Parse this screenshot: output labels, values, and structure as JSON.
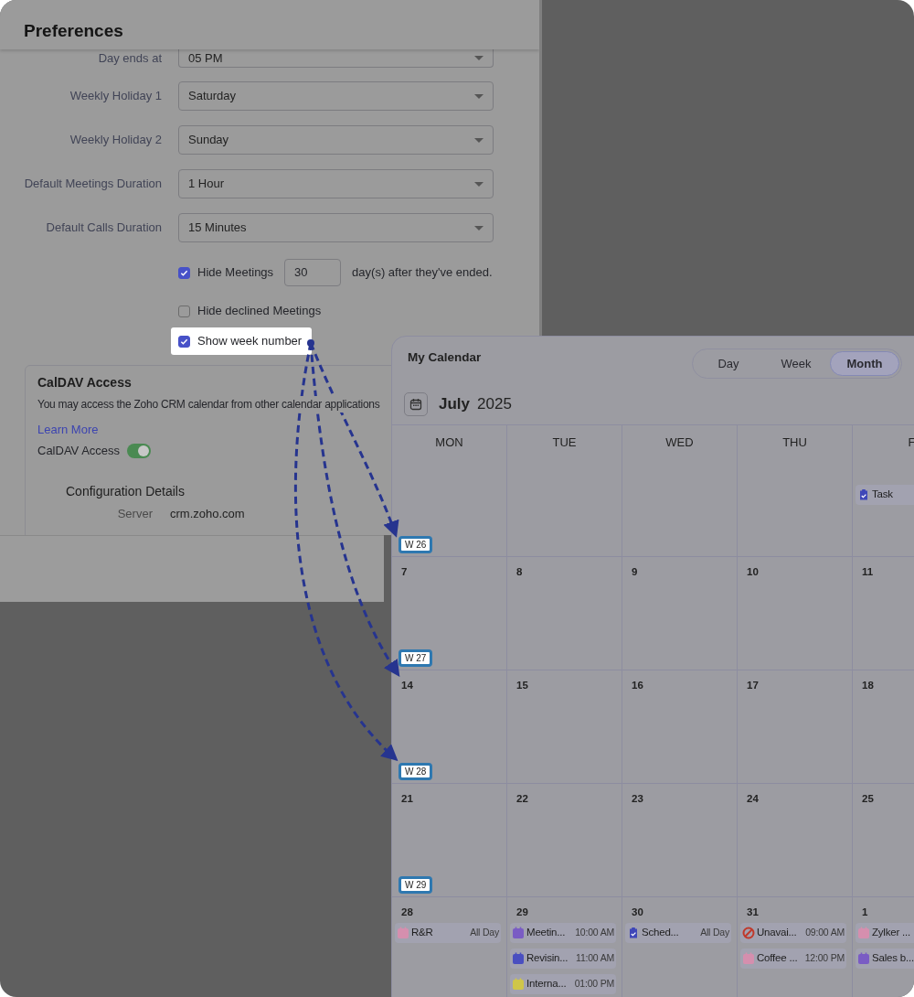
{
  "preferences": {
    "title": "Preferences",
    "fields": [
      {
        "label": "Day ends at",
        "value": "05 PM"
      },
      {
        "label": "Weekly Holiday 1",
        "value": "Saturday"
      },
      {
        "label": "Weekly Holiday 2",
        "value": "Sunday"
      },
      {
        "label": "Default Meetings Duration",
        "value": "1 Hour"
      },
      {
        "label": "Default Calls Duration",
        "value": "15 Minutes"
      }
    ],
    "options": [
      {
        "label": "Hide Meetings",
        "checked": true,
        "highlighted": false,
        "days": "30",
        "suffix": "day(s) after they've ended."
      },
      {
        "label": "Hide declined Meetings",
        "checked": false,
        "highlighted": false
      },
      {
        "label": "Show week number",
        "checked": true,
        "highlighted": true
      }
    ],
    "caldav": {
      "title": "CalDAV Access",
      "description": "You may access the Zoho CRM calendar from other calendar applications",
      "link": "Learn More",
      "toggle_label": "CalDAV Access",
      "on": true,
      "config_title": "Configuration Details",
      "config": [
        {
          "label": "Server",
          "value": "crm.zoho.com"
        }
      ]
    }
  },
  "calendar": {
    "title": "My Calendar",
    "views": [
      {
        "label": "Day",
        "selected": false
      },
      {
        "label": "Week",
        "selected": false
      },
      {
        "label": "Month",
        "selected": true
      }
    ],
    "month": "July",
    "year": "2025",
    "weekdays": [
      "MON",
      "TUE",
      "WED",
      "THU",
      "F"
    ],
    "weeks": [
      {
        "kind": "partial",
        "week_label": "W 26",
        "days": [
          {
            "events": [
              {
                "kind": "task",
                "title": "Task",
                "color": "#3f47b8"
              }
            ]
          }
        ]
      },
      {
        "kind": "full",
        "week_label": "W 27",
        "days": [
          {
            "date": "7"
          },
          {
            "date": "8"
          },
          {
            "date": "9"
          },
          {
            "date": "10"
          },
          {
            "date": "11"
          }
        ]
      },
      {
        "kind": "full",
        "week_label": "W 28",
        "days": [
          {
            "date": "14"
          },
          {
            "date": "15"
          },
          {
            "date": "16"
          },
          {
            "date": "17"
          },
          {
            "date": "18"
          }
        ]
      },
      {
        "kind": "full",
        "week_label": "W 29",
        "days": [
          {
            "date": "21"
          },
          {
            "date": "22"
          },
          {
            "date": "23"
          },
          {
            "date": "24"
          },
          {
            "date": "25"
          }
        ]
      },
      {
        "kind": "full",
        "days": [
          {
            "date": "28",
            "events": [
              {
                "kind": "event",
                "title": "R&R",
                "time": "All Day",
                "color": "#d58fae"
              }
            ]
          },
          {
            "date": "29",
            "events": [
              {
                "kind": "event",
                "title": "Meetin...",
                "time": "10:00 AM",
                "color": "#7a5cc4"
              },
              {
                "kind": "event",
                "title": "Revisin...",
                "time": "11:00 AM",
                "color": "#4a4fc0"
              },
              {
                "kind": "event",
                "title": "Interna...",
                "time": "01:00 PM",
                "color": "#cfc64a"
              }
            ]
          },
          {
            "date": "30",
            "events": [
              {
                "kind": "task",
                "title": "Sched...",
                "time": "All Day",
                "color": "#3f47b8"
              }
            ]
          },
          {
            "date": "31",
            "events": [
              {
                "kind": "unavailable",
                "title": "Unavai...",
                "time": "09:00 AM",
                "color": "#c0392b"
              },
              {
                "kind": "event",
                "title": "Coffee ...",
                "time": "12:00 PM",
                "color": "#d58fae"
              }
            ]
          },
          {
            "date": "1",
            "events": [
              {
                "kind": "event",
                "title": "Zylker ...",
                "color": "#d58fae"
              },
              {
                "kind": "event",
                "title": "Sales b...",
                "color": "#7a5cc4"
              }
            ]
          }
        ]
      }
    ]
  }
}
